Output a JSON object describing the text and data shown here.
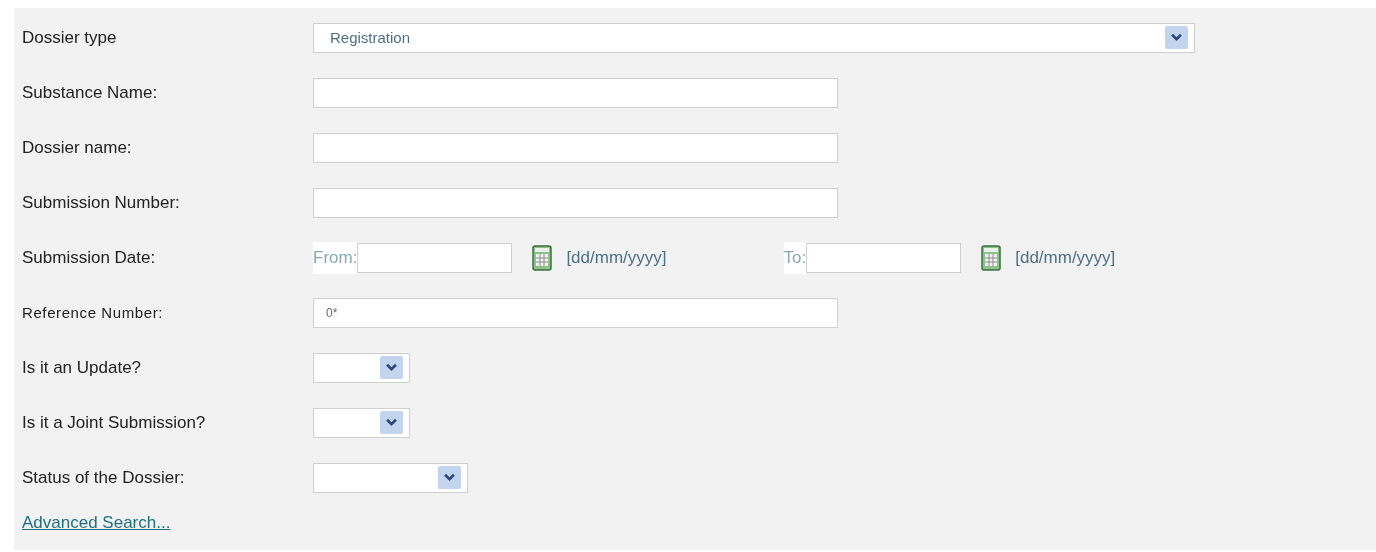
{
  "rows": [
    {
      "kind": "select",
      "label": "Dossier type",
      "value": "Registration"
    },
    {
      "kind": "text",
      "label": "Substance Name:"
    },
    {
      "kind": "text",
      "label": "Dossier name:"
    },
    {
      "kind": "text",
      "label": "Submission Number:"
    },
    {
      "kind": "date",
      "label": "Submission Date:",
      "from_label": "From:",
      "from_format": "[dd/mm/yyyy]",
      "to_label": "To:",
      "to_format": "[dd/mm/yyyy]"
    },
    {
      "kind": "text",
      "label": "Reference Number:",
      "value": "0*"
    },
    {
      "kind": "select",
      "label": "Is it an Update?"
    },
    {
      "kind": "select",
      "label": "Is it a Joint Submission?"
    },
    {
      "kind": "select",
      "label": "Status of the Dossier:"
    }
  ],
  "advanced_link": "Advanced Search..."
}
